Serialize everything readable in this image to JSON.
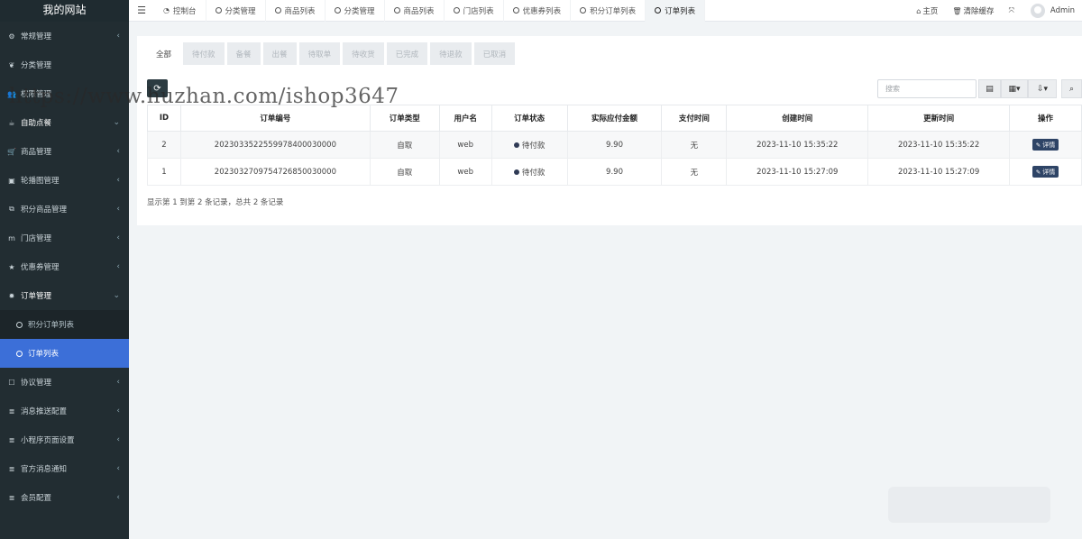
{
  "sidebar": {
    "logo": "我的网站",
    "items": [
      {
        "label": "常规管理",
        "icon": "gears-icon",
        "glyph": "⚙",
        "chev": "‹"
      },
      {
        "label": "分类管理",
        "icon": "leaf-icon",
        "glyph": "❦",
        "chev": ""
      },
      {
        "label": "权限管理",
        "icon": "users-icon",
        "glyph": "👥",
        "chev": ""
      },
      {
        "label": "自助点餐",
        "icon": "coffee-icon",
        "glyph": "☕",
        "chev": "⌄"
      },
      {
        "label": "商品管理",
        "icon": "cart-icon",
        "glyph": "🛒",
        "chev": "‹"
      },
      {
        "label": "轮播图管理",
        "icon": "image-icon",
        "glyph": "▣",
        "chev": "‹"
      },
      {
        "label": "积分商品管理",
        "icon": "gift-icon",
        "glyph": "⧉",
        "chev": "‹"
      },
      {
        "label": "门店管理",
        "icon": "store-icon",
        "glyph": "m",
        "chev": "‹"
      },
      {
        "label": "优惠券管理",
        "icon": "star-icon",
        "glyph": "★",
        "chev": "‹"
      },
      {
        "label": "订单管理",
        "icon": "gear-icon",
        "glyph": "✹",
        "chev": "⌄"
      }
    ],
    "subitems": [
      {
        "label": "积分订单列表"
      },
      {
        "label": "订单列表"
      }
    ],
    "items_after": [
      {
        "label": "协议管理",
        "icon": "file-icon",
        "glyph": "☐",
        "chev": "‹"
      },
      {
        "label": "消息推送配置",
        "icon": "list-icon",
        "glyph": "≣",
        "chev": "‹"
      },
      {
        "label": "小程序页面设置",
        "icon": "list-icon",
        "glyph": "≣",
        "chev": "‹"
      },
      {
        "label": "官方消息通知",
        "icon": "list-icon",
        "glyph": "≣",
        "chev": "‹"
      },
      {
        "label": "会员配置",
        "icon": "list-icon",
        "glyph": "≣",
        "chev": "‹"
      }
    ]
  },
  "topbar": {
    "tabs": [
      {
        "label": "控制台",
        "icon": "dashboard-icon"
      },
      {
        "label": "分类管理",
        "icon": "circle-icon"
      },
      {
        "label": "商品列表",
        "icon": "circle-icon"
      },
      {
        "label": "分类管理",
        "icon": "circle-icon"
      },
      {
        "label": "商品列表",
        "icon": "circle-icon"
      },
      {
        "label": "门店列表",
        "icon": "circle-icon"
      },
      {
        "label": "优惠券列表",
        "icon": "circle-icon"
      },
      {
        "label": "积分订单列表",
        "icon": "circle-icon"
      },
      {
        "label": "订单列表",
        "icon": "circle-icon"
      }
    ],
    "home": "主页",
    "clear_cache": "清除缓存",
    "user": "Admin"
  },
  "status_tabs": [
    "全部",
    "待付款",
    "备餐",
    "出餐",
    "待取单",
    "待收货",
    "已完成",
    "待退款",
    "已取消"
  ],
  "search": {
    "placeholder": "搜索"
  },
  "table": {
    "headers": [
      "ID",
      "订单编号",
      "订单类型",
      "用户名",
      "订单状态",
      "实际应付金额",
      "支付时间",
      "创建时间",
      "更新时间",
      "操作"
    ],
    "rows": [
      {
        "id": "2",
        "order_no": "2023033522559978400030000",
        "type": "自取",
        "user": "web",
        "status": "待付款",
        "amount": "9.90",
        "pay_time": "无",
        "created": "2023-11-10 15:35:22",
        "updated": "2023-11-10 15:35:22",
        "action": "详情"
      },
      {
        "id": "1",
        "order_no": "2023032709754726850030000",
        "type": "自取",
        "user": "web",
        "status": "待付款",
        "amount": "9.90",
        "pay_time": "无",
        "created": "2023-11-10 15:27:09",
        "updated": "2023-11-10 15:27:09",
        "action": "详情"
      }
    ]
  },
  "pager_text": "显示第 1 到第 2 条记录，总共 2 条记录",
  "watermark": "https://www.huzhan.com/ishop3647",
  "colors": {
    "sidebar_bg": "#222d32",
    "active_item": "#3c6fd8",
    "detail_btn": "#2e4466"
  }
}
